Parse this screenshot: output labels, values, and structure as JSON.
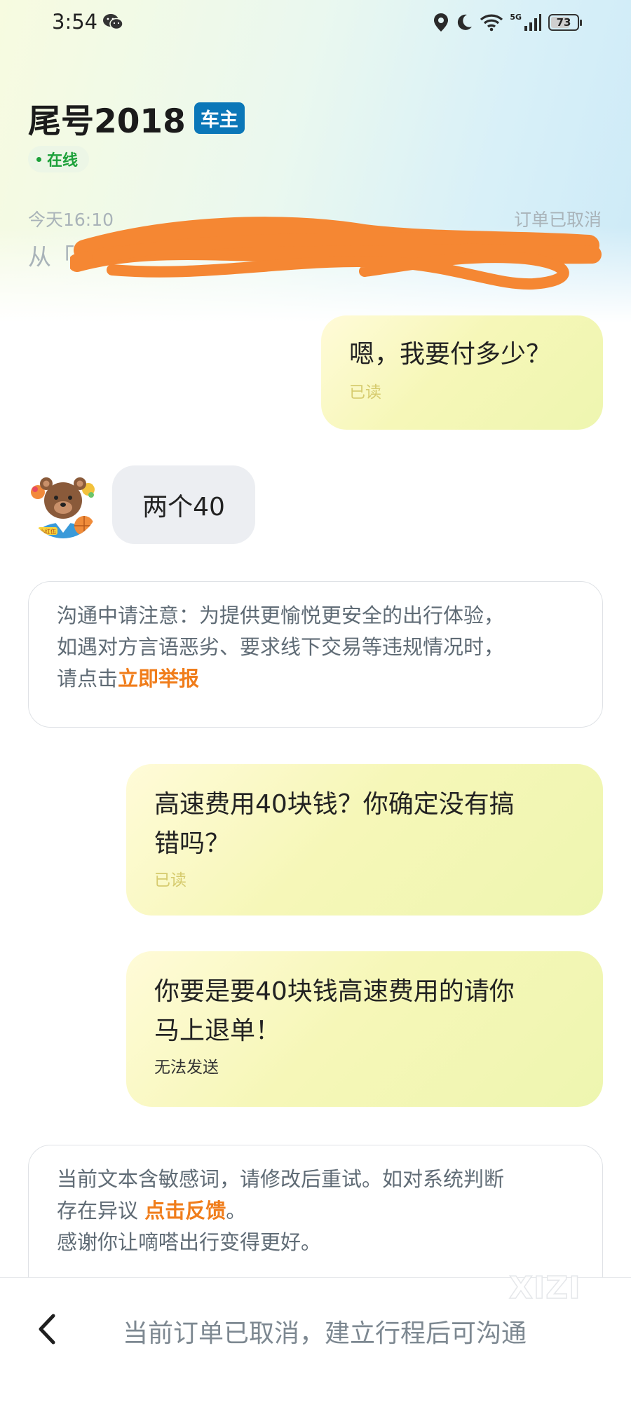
{
  "status_bar": {
    "time": "3:54",
    "network": "5G",
    "battery": "73",
    "battery_level_percent": 73,
    "icons": [
      "wechat-icon",
      "location-icon",
      "moon-icon",
      "wifi-icon",
      "signal-icon",
      "battery-icon"
    ]
  },
  "header": {
    "title": "尾号2018",
    "role_badge": "车主",
    "online_status": "在线",
    "trip_time": "今天16:10",
    "trip_status": "订单已取消",
    "trip_from": "从「"
  },
  "messages": [
    {
      "side": "right",
      "text": "嗯，我要付多少？",
      "status": "已读"
    },
    {
      "side": "left",
      "text": "两个40"
    },
    {
      "side": "right",
      "text_lines": [
        "高速费用40块钱？你确定没有搞",
        "错吗？"
      ],
      "status": "已读"
    },
    {
      "side": "right",
      "text_lines": [
        "你要是要40块钱高速费用的请你",
        "马上退单！"
      ],
      "status": "无法发送"
    }
  ],
  "notices": {
    "safety": {
      "lines": [
        "沟通中请注意：为提供更愉悦更安全的出行体验，",
        "如遇对方言语恶劣、要求线下交易等违规情况时，",
        "请点击"
      ],
      "link": "立即举报"
    },
    "sensitive": {
      "line1": "当前文本含敏感词，请修改后重试。如对系统判断",
      "line2_prefix": "存在异议 ",
      "link": "点击反馈",
      "line2_suffix": "。",
      "line3": "感谢你让嘀嗒出行变得更好。"
    }
  },
  "avatar": {
    "badge": "小红伍"
  },
  "bottom_bar": {
    "hint": "当前订单已取消，建立行程后可沟通",
    "back_icon": "chevron-left-icon"
  },
  "watermark": "XIZI",
  "colors": {
    "role_badge": "#0b77b8",
    "online": "#1da13a",
    "link": "#f07d1b",
    "read_mark": "#d6cb6e",
    "scribble": "#f58733"
  }
}
